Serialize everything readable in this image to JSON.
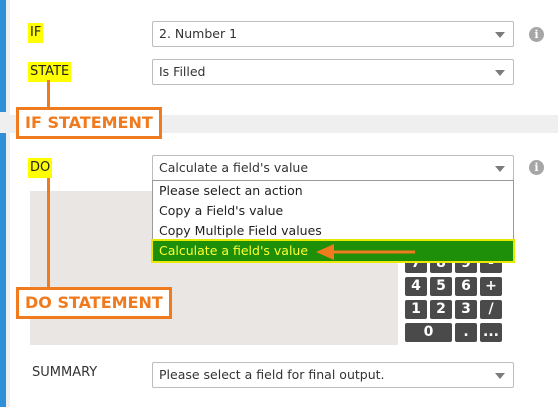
{
  "if_section": {
    "if_label": "IF",
    "state_label": "STATE",
    "field_select": "2. Number 1",
    "state_select": "Is Filled",
    "callout": "IF STATEMENT"
  },
  "do_section": {
    "do_label": "DO",
    "action_select": "Calculate a field's value",
    "callout": "DO STATEMENT",
    "dropdown_options": [
      "Please select an action",
      "Copy a Field's value",
      "Copy Multiple Field values",
      "Calculate a field's value"
    ],
    "selected_option_index": 3,
    "calculator_keys": [
      "7",
      "8",
      "9",
      "-",
      "4",
      "5",
      "6",
      "+",
      "1",
      "2",
      "3",
      "/",
      "0",
      ".",
      "..."
    ]
  },
  "summary": {
    "label": "SUMMARY",
    "placeholder": "Please select a field for final output."
  },
  "icons": {
    "info": "i"
  },
  "colors": {
    "accent_blue": "#2f8fd8",
    "callout_orange": "#f07a1e",
    "highlight_yellow": "#ffff00",
    "selected_green": "#1e8f09"
  }
}
